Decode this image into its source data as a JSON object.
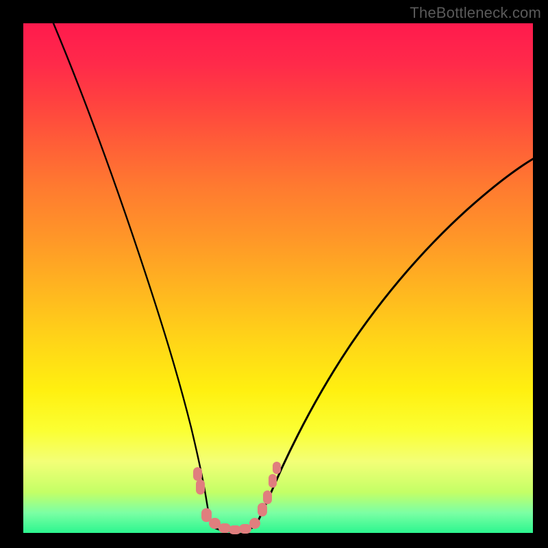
{
  "watermark": "TheBottleneck.com",
  "chart_data": {
    "type": "line",
    "title": "",
    "xlabel": "",
    "ylabel": "",
    "xlim": [
      0,
      100
    ],
    "ylim": [
      0,
      100
    ],
    "grid": false,
    "legend": false,
    "note": "Axes unlabeled in source image; values are estimated percentages of plot width/height with y=0 at the bottom (green) and y=100 at the top (red).",
    "series": [
      {
        "name": "left-branch",
        "x": [
          6,
          10,
          14,
          18,
          22,
          26,
          29,
          31,
          33,
          34.5,
          36
        ],
        "y": [
          100,
          84,
          68,
          53,
          39,
          27,
          18,
          12,
          8,
          5,
          3
        ]
      },
      {
        "name": "right-branch",
        "x": [
          46,
          48,
          51,
          55,
          60,
          66,
          73,
          81,
          90,
          100
        ],
        "y": [
          3,
          6,
          11,
          18,
          27,
          37,
          47,
          57,
          66,
          73
        ]
      },
      {
        "name": "valley-floor",
        "x": [
          36,
          38,
          40,
          42,
          44,
          46
        ],
        "y": [
          3,
          1.5,
          1,
          1,
          1.5,
          3
        ]
      }
    ],
    "markers": {
      "description": "Pink rounded segments overlaid along the bottom of the V-curve",
      "color": "#e07e7e",
      "points": [
        {
          "x": 34.2,
          "y": 11.5
        },
        {
          "x": 34.8,
          "y": 9.0
        },
        {
          "x": 36.0,
          "y": 3.0
        },
        {
          "x": 37.2,
          "y": 1.8
        },
        {
          "x": 38.6,
          "y": 1.2
        },
        {
          "x": 40.2,
          "y": 1.0
        },
        {
          "x": 41.8,
          "y": 1.0
        },
        {
          "x": 43.4,
          "y": 1.2
        },
        {
          "x": 45.0,
          "y": 2.0
        },
        {
          "x": 46.8,
          "y": 4.8
        },
        {
          "x": 47.6,
          "y": 7.0
        },
        {
          "x": 48.8,
          "y": 10.5
        },
        {
          "x": 49.6,
          "y": 13.0
        }
      ]
    },
    "background_gradient": {
      "top_color": "#ff1a4d",
      "mid_color": "#ffd418",
      "bottom_color": "#2cf68f"
    }
  }
}
